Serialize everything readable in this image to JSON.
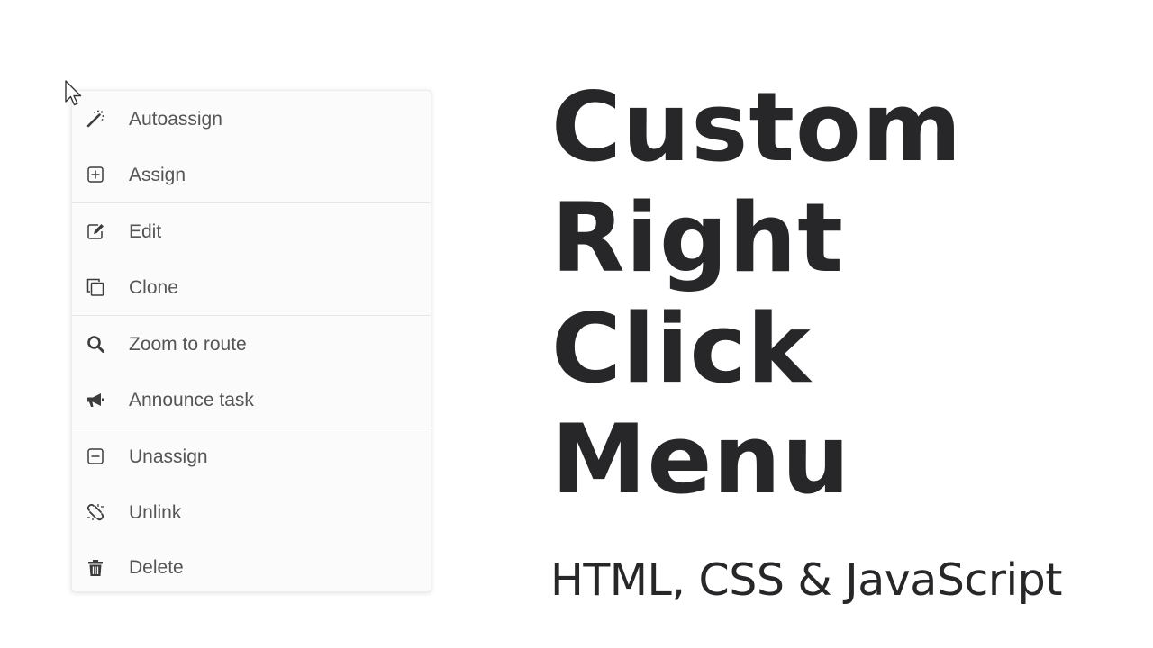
{
  "context_menu": {
    "groups": [
      {
        "items": [
          {
            "label": "Autoassign",
            "icon": "magic-wand-icon"
          },
          {
            "label": "Assign",
            "icon": "plus-square-icon"
          }
        ]
      },
      {
        "items": [
          {
            "label": "Edit",
            "icon": "edit-icon"
          },
          {
            "label": "Clone",
            "icon": "clone-icon"
          }
        ]
      },
      {
        "items": [
          {
            "label": "Zoom to route",
            "icon": "search-icon"
          },
          {
            "label": "Announce task",
            "icon": "megaphone-icon"
          }
        ]
      },
      {
        "items": [
          {
            "label": "Unassign",
            "icon": "minus-square-icon"
          },
          {
            "label": "Unlink",
            "icon": "unlink-icon"
          },
          {
            "label": "Delete",
            "icon": "trash-icon"
          }
        ]
      }
    ]
  },
  "heading": {
    "lines": [
      "Custom",
      "Right",
      "Click",
      "Menu"
    ]
  },
  "subtitle": "HTML, CSS & JavaScript",
  "colors": {
    "menu_background": "#fbfbfb",
    "menu_text": "#555555",
    "divider": "#e6e6e6",
    "heading_text": "#27272a"
  }
}
